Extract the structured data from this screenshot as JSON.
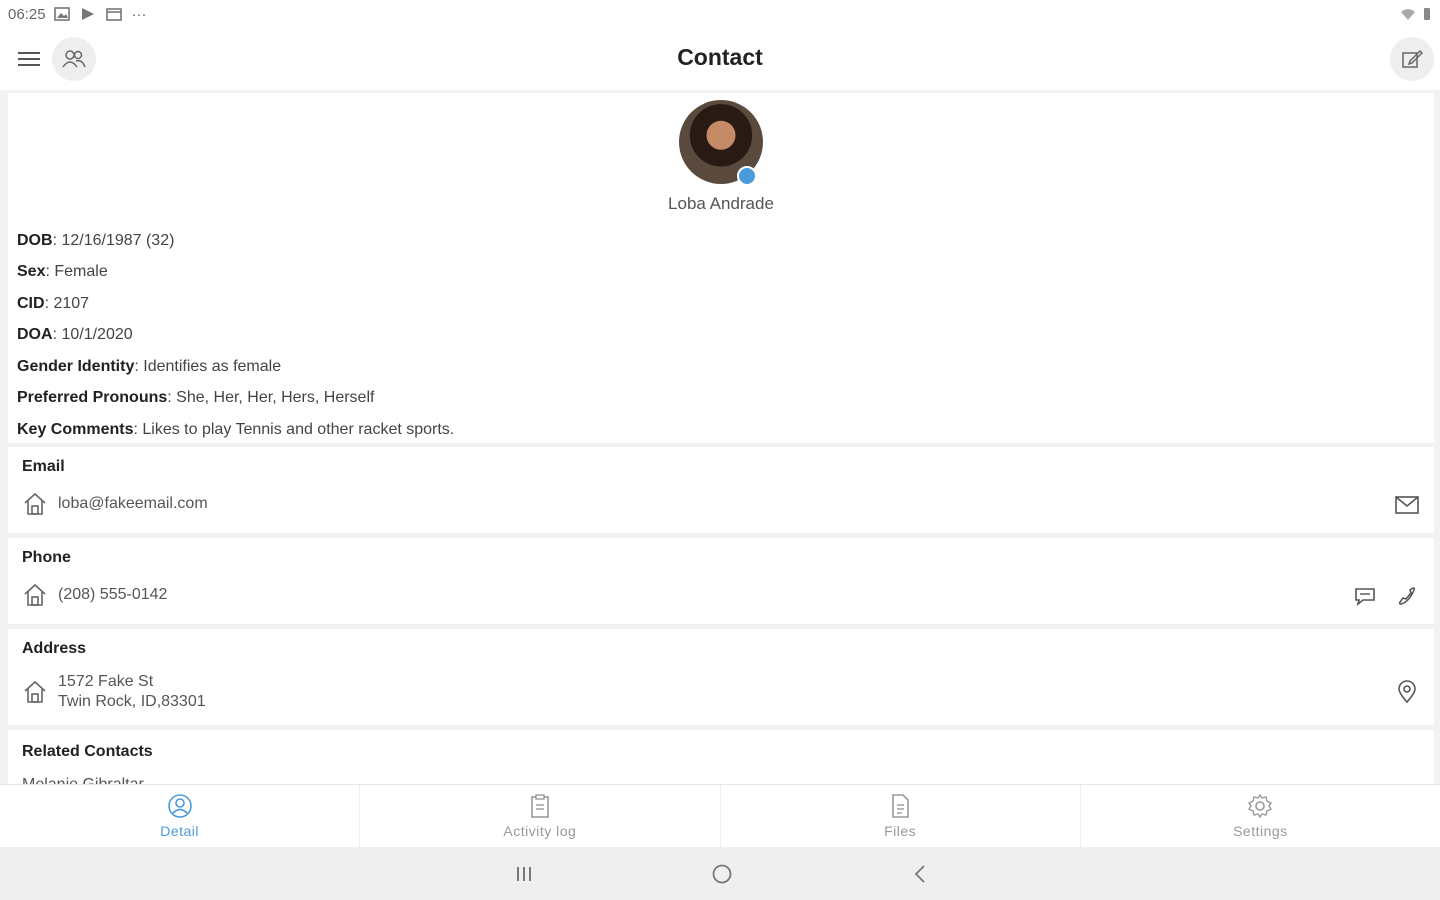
{
  "status_bar": {
    "time": "06:25",
    "more": "···"
  },
  "app_bar": {
    "title": "Contact"
  },
  "profile": {
    "name": "Loba Andrade",
    "fields": [
      {
        "key": "DOB",
        "value": ": 12/16/1987 (32)"
      },
      {
        "key": "Sex",
        "value": ": Female"
      },
      {
        "key": "CID",
        "value": ": 2107"
      },
      {
        "key": "DOA",
        "value": ": 10/1/2020"
      },
      {
        "key": "Gender Identity",
        "value": ": Identifies as female"
      },
      {
        "key": "Preferred Pronouns",
        "value": ": She, Her, Her, Hers, Herself"
      },
      {
        "key": "Key Comments",
        "value": ": Likes to play Tennis and other racket sports."
      }
    ]
  },
  "email": {
    "title": "Email",
    "value": "loba@fakeemail.com"
  },
  "phone": {
    "title": "Phone",
    "value": "(208) 555-0142"
  },
  "address": {
    "title": "Address",
    "line1": "1572 Fake St",
    "line2": "Twin Rock, ID,83301"
  },
  "related": {
    "title": "Related Contacts",
    "first_item": "Melanie Gibraltar"
  },
  "tabs": [
    {
      "label": "Detail",
      "icon": "person-circle-icon"
    },
    {
      "label": "Activity log",
      "icon": "clipboard-icon"
    },
    {
      "label": "Files",
      "icon": "document-icon"
    },
    {
      "label": "Settings",
      "icon": "gear-icon"
    }
  ],
  "colors": {
    "accent": "#4a9bdc",
    "background": "#f2f2f2",
    "card": "#ffffff",
    "muted": "#999999"
  }
}
